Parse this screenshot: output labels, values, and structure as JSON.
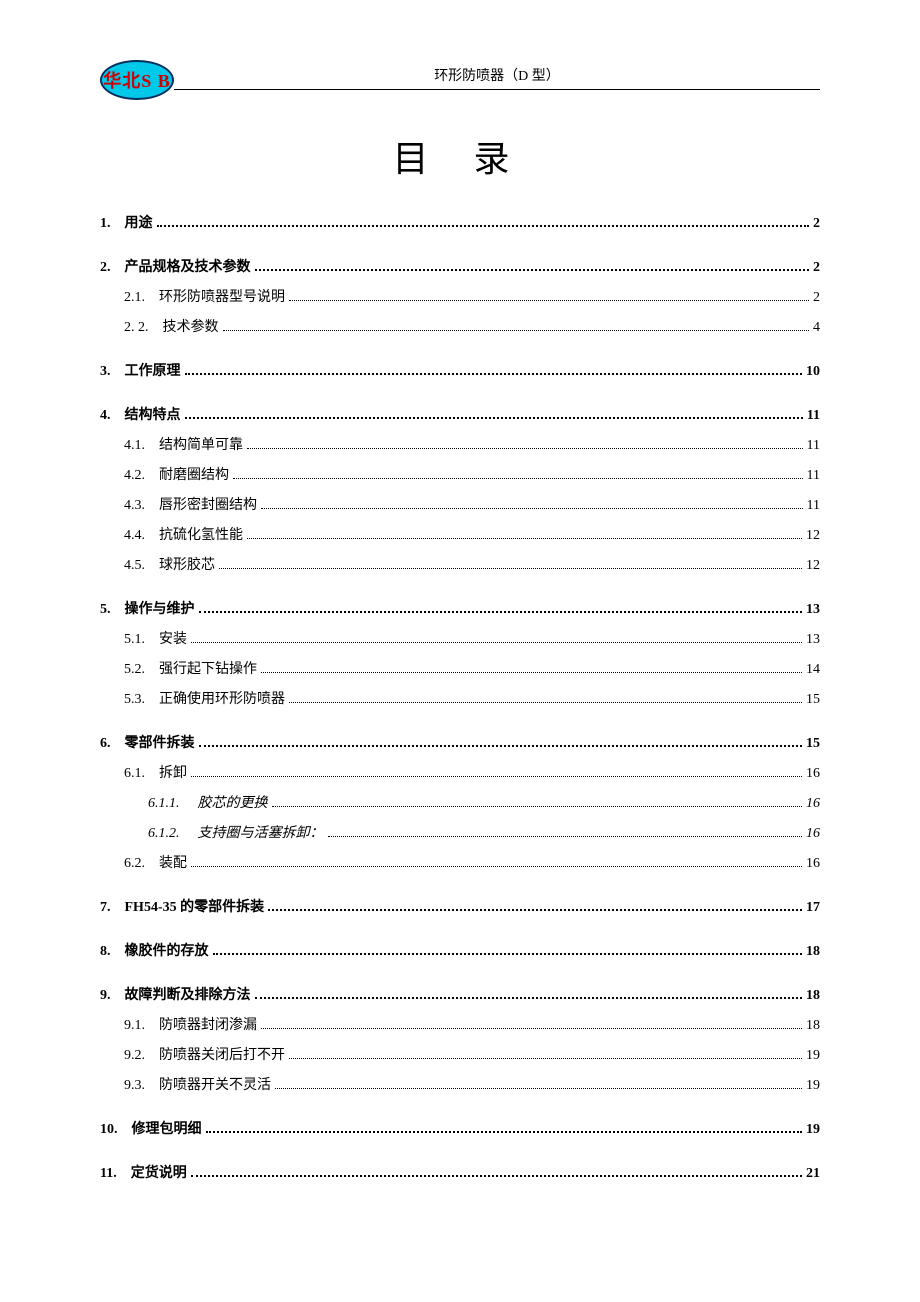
{
  "header": {
    "logo_text": "华北S B",
    "title": "环形防喷器（D 型）"
  },
  "toc_title": "目 录",
  "toc": [
    {
      "level": 1,
      "num": "1.",
      "text": "用途",
      "page": "2"
    },
    {
      "level": 1,
      "num": "2.",
      "text": "产品规格及技术参数",
      "page": "2"
    },
    {
      "level": 2,
      "num": "2.1.",
      "text": "环形防喷器型号说明",
      "page": "2"
    },
    {
      "level": 2,
      "num": "2. 2.",
      "text": "技术参数",
      "page": "4"
    },
    {
      "level": 1,
      "num": "3.",
      "text": "工作原理",
      "page": "10"
    },
    {
      "level": 1,
      "num": "4.",
      "text": "结构特点",
      "page": "11"
    },
    {
      "level": 2,
      "num": "4.1.",
      "text": "结构简单可靠",
      "page": "11"
    },
    {
      "level": 2,
      "num": "4.2.",
      "text": "耐磨圈结构",
      "page": "11"
    },
    {
      "level": 2,
      "num": "4.3.",
      "text": "唇形密封圈结构",
      "page": "11"
    },
    {
      "level": 2,
      "num": "4.4.",
      "text": "抗硫化氢性能",
      "page": "12"
    },
    {
      "level": 2,
      "num": "4.5.",
      "text": "球形胶芯",
      "page": "12"
    },
    {
      "level": 1,
      "num": "5.",
      "text": "操作与维护",
      "page": "13"
    },
    {
      "level": 2,
      "num": "5.1.",
      "text": "安装",
      "page": "13"
    },
    {
      "level": 2,
      "num": "5.2.",
      "text": "强行起下钻操作",
      "page": "14"
    },
    {
      "level": 2,
      "num": "5.3.",
      "text": "正确使用环形防喷器",
      "page": "15"
    },
    {
      "level": 1,
      "num": "6.",
      "text": "零部件拆装",
      "page": "15"
    },
    {
      "level": 2,
      "num": "6.1.",
      "text": "拆卸",
      "page": "16"
    },
    {
      "level": 3,
      "num": "6.1.1.",
      "text": "胶芯的更换",
      "page": "16"
    },
    {
      "level": 3,
      "num": "6.1.2.",
      "text": "支持圈与活塞拆卸：",
      "page": "16"
    },
    {
      "level": 2,
      "num": "6.2.",
      "text": "装配",
      "page": "16"
    },
    {
      "level": 1,
      "num": "7.",
      "text": "FH54-35 的零部件拆装",
      "page": "17"
    },
    {
      "level": 1,
      "num": "8.",
      "text": "橡胶件的存放",
      "page": "18"
    },
    {
      "level": 1,
      "num": "9.",
      "text": "故障判断及排除方法",
      "page": "18"
    },
    {
      "level": 2,
      "num": "9.1.",
      "text": "防喷器封闭渗漏",
      "page": "18"
    },
    {
      "level": 2,
      "num": "9.2.",
      "text": "防喷器关闭后打不开",
      "page": "19"
    },
    {
      "level": 2,
      "num": "9.3.",
      "text": "防喷器开关不灵活",
      "page": "19"
    },
    {
      "level": 1,
      "num": "10.",
      "text": "修理包明细",
      "page": "19"
    },
    {
      "level": 1,
      "num": "11.",
      "text": "定货说明",
      "page": "21"
    }
  ]
}
